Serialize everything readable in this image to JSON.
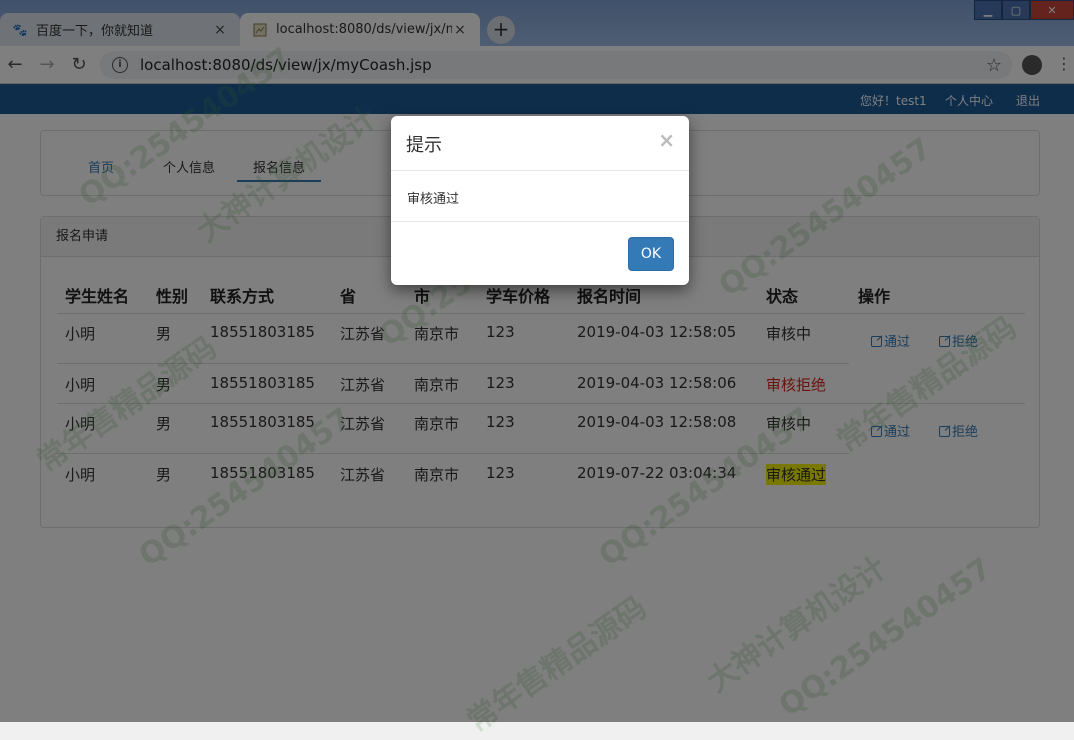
{
  "browser": {
    "tabs": [
      {
        "title": "百度一下，你就知道",
        "icon": "paw-icon",
        "active": false
      },
      {
        "title": "localhost:8080/ds/view/jx/my",
        "icon": "page-icon",
        "active": true
      }
    ],
    "url": "localhost:8080/ds/view/jx/myCoash.jsp",
    "close_glyph": "×",
    "new_tab_glyph": "+"
  },
  "topnav": {
    "greeting": "您好！test1",
    "profile": "个人中心",
    "logout": "退出"
  },
  "nav": {
    "tabs": [
      {
        "label": "首页",
        "selected": false
      },
      {
        "label": "个人信息",
        "selected": false
      },
      {
        "label": "报名信息",
        "selected": true
      }
    ]
  },
  "registrations": {
    "heading": "报名申请",
    "columns": [
      "学生姓名",
      "性别",
      "联系方式",
      "省",
      "市",
      "学车价格",
      "报名时间",
      "状态",
      "操作"
    ],
    "rows": [
      {
        "name": "小明",
        "gender": "男",
        "phone": "18551803185",
        "province": "江苏省",
        "city": "南京市",
        "price": "123",
        "time": "2019-04-03 12:58:05",
        "status": "审核中",
        "actions": true
      },
      {
        "name": "小明",
        "gender": "男",
        "phone": "18551803185",
        "province": "江苏省",
        "city": "南京市",
        "price": "123",
        "time": "2019-04-03 12:58:06",
        "status": "审核拒绝",
        "actions": false
      },
      {
        "name": "小明",
        "gender": "男",
        "phone": "18551803185",
        "province": "江苏省",
        "city": "南京市",
        "price": "123",
        "time": "2019-04-03 12:58:08",
        "status": "审核中",
        "actions": true
      },
      {
        "name": "小明",
        "gender": "男",
        "phone": "18551803185",
        "province": "江苏省",
        "city": "南京市",
        "price": "123",
        "time": "2019-07-22 03:04:34",
        "status": "审核通过",
        "actions": false
      }
    ],
    "approve_label": "通过",
    "reject_label": "拒绝"
  },
  "modal": {
    "title": "提示",
    "close_glyph": "×",
    "message": "审核通过",
    "ok_label": "OK"
  },
  "watermark": {
    "qq": "QQ:254540457",
    "text1": "大神计算机设计",
    "text2": "常年售精品源码"
  },
  "colors": {
    "topnav": "#1a5b97",
    "primary": "#337ab7",
    "rejected": "#d9251c",
    "approved_highlight": "#f3f000"
  }
}
